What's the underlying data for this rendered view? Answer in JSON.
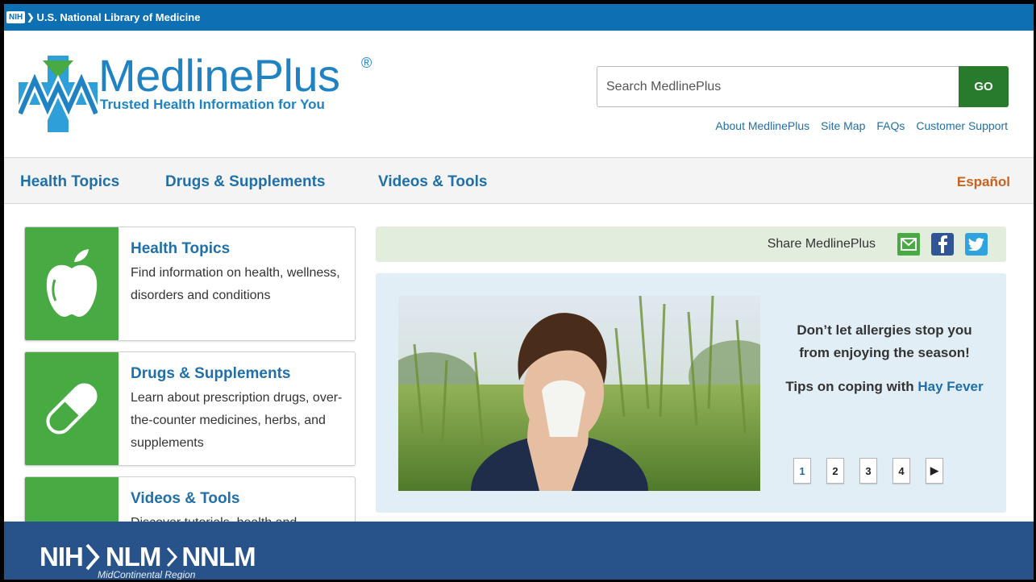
{
  "top_bar": {
    "title": "U.S. National Library of Medicine",
    "badge": "NIH"
  },
  "header": {
    "logo_name": "MedlinePlus",
    "logo_reg": "®",
    "tagline": "Trusted Health Information for You",
    "search": {
      "placeholder": "Search MedlinePlus",
      "value": "",
      "button": "GO"
    },
    "util_links": [
      "About MedlinePlus",
      "Site Map",
      "FAQs",
      "Customer Support"
    ]
  },
  "nav": {
    "items": [
      "Health Topics",
      "Drugs & Supplements",
      "Videos & Tools"
    ],
    "language": "Español"
  },
  "cards": [
    {
      "title": "Health Topics",
      "desc": "Find information on health, wellness, disorders and conditions",
      "icon": "apple-icon"
    },
    {
      "title": "Drugs & Supplements",
      "desc": "Learn about prescription drugs, over-the-counter medicines, herbs, and supplements",
      "icon": "pill-icon"
    },
    {
      "title": "Videos & Tools",
      "desc": "Discover tutorials, health and",
      "icon": "video-icon"
    }
  ],
  "share": {
    "label": "Share MedlinePlus",
    "icons": [
      "email-icon",
      "facebook-icon",
      "twitter-icon"
    ]
  },
  "feature": {
    "headline": "Don’t let allergies stop you from enjoying the season!",
    "tips_prefix": "Tips on coping with ",
    "tips_link": "Hay Fever",
    "pages": [
      "1",
      "2",
      "3",
      "4"
    ],
    "next": "▶"
  },
  "footer_band": {
    "nih": "NIH",
    "nlm": "NLM",
    "nnlm": "NNLM",
    "sub": "MidContinental Region"
  },
  "colors": {
    "nih_blue": "#0e6fb3",
    "brand_blue": "#1f82c3",
    "green": "#47aa42",
    "go_green": "#287a2d",
    "band": "#27538a",
    "espanol": "#c9621f"
  }
}
